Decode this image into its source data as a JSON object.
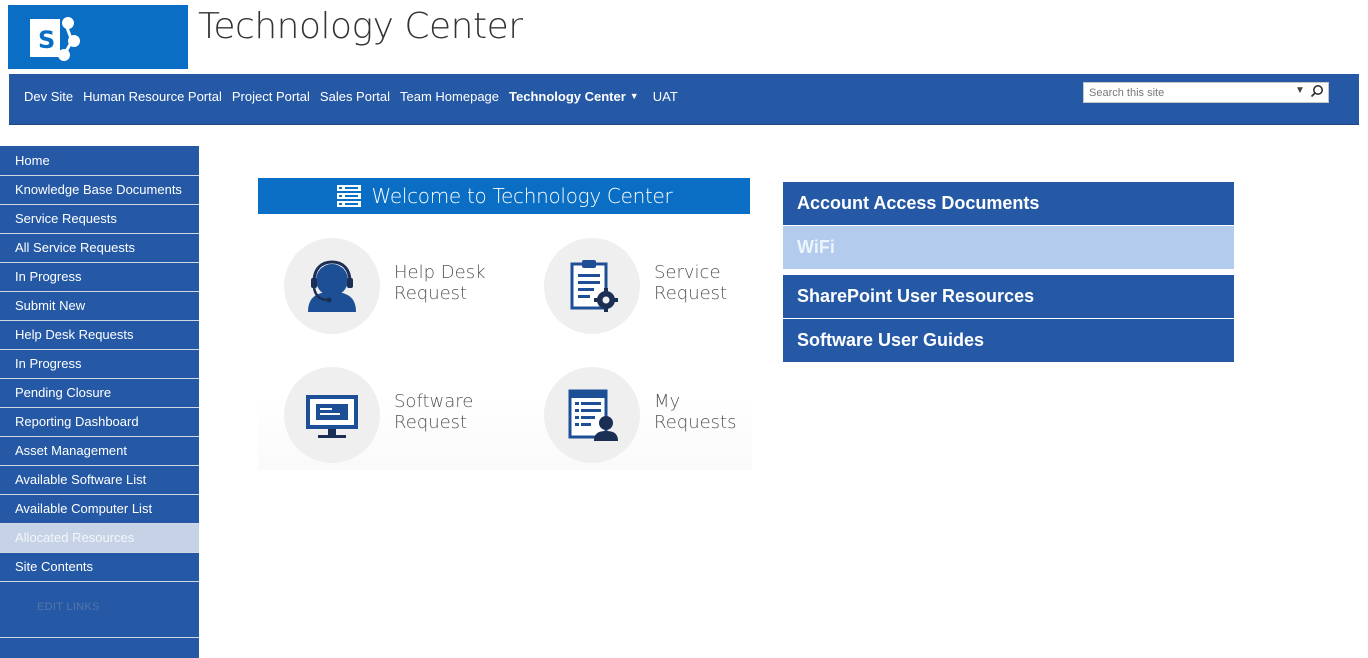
{
  "header": {
    "site_title": "Technology Center",
    "logo_icon": "sharepoint-logo-icon"
  },
  "topnav": {
    "items": [
      {
        "label": "Dev Site"
      },
      {
        "label": "Human Resource Portal"
      },
      {
        "label": "Project Portal"
      },
      {
        "label": "Sales Portal"
      },
      {
        "label": "Team Homepage"
      },
      {
        "label": "Technology Center",
        "active": true
      },
      {
        "label": "UAT"
      }
    ],
    "search_placeholder": "Search this site"
  },
  "leftnav": {
    "items": [
      {
        "label": "Home"
      },
      {
        "label": "Knowledge Base Documents"
      },
      {
        "label": "Service Requests"
      },
      {
        "label": "All Service Requests"
      },
      {
        "label": "In Progress"
      },
      {
        "label": "Submit New"
      },
      {
        "label": "Help Desk Requests"
      },
      {
        "label": "In Progress"
      },
      {
        "label": "Pending Closure"
      },
      {
        "label": "Reporting Dashboard"
      },
      {
        "label": "Asset Management"
      },
      {
        "label": "Available Software List"
      },
      {
        "label": "Available Computer List"
      },
      {
        "label": "Allocated Resources",
        "selected": true
      },
      {
        "label": "Site Contents"
      }
    ],
    "edit_links": "EDIT LINKS"
  },
  "welcome": {
    "banner_text": "Welcome to Technology Center",
    "tiles": [
      {
        "line1": "Help Desk",
        "line2": "Request",
        "icon": "headset-user-icon"
      },
      {
        "line1": "Service",
        "line2": "Request",
        "icon": "clipboard-gear-icon"
      },
      {
        "line1": "Software",
        "line2": "Request",
        "icon": "monitor-icon"
      },
      {
        "line1": "My",
        "line2": "Requests",
        "icon": "document-user-icon"
      }
    ]
  },
  "right_links": [
    {
      "label": "Account Access Documents"
    },
    {
      "label": "WiFi"
    },
    {
      "label": "SharePoint User Resources"
    },
    {
      "label": "Software User Guides"
    }
  ],
  "colors": {
    "nav_blue": "#2559a6",
    "brand_blue": "#0a6fc4",
    "selected_light": "#c6d3e6",
    "wifi_light": "#b3cbec"
  }
}
